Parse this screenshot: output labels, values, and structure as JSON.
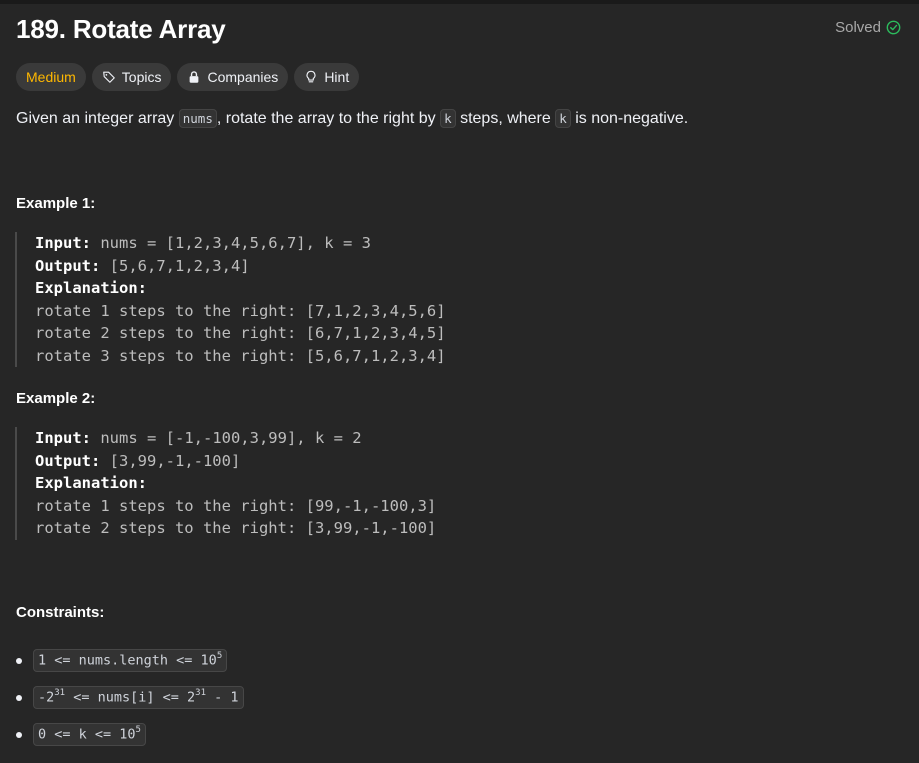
{
  "problem": {
    "title": "189. Rotate Array",
    "status": "Solved"
  },
  "tags": {
    "difficulty": "Medium",
    "topics": "Topics",
    "companies": "Companies",
    "hint": "Hint"
  },
  "description": {
    "part1": "Given an integer array ",
    "code1": "nums",
    "part2": ", rotate the array to the right by ",
    "code2": "k",
    "part3": " steps, where ",
    "code3": "k",
    "part4": " is non-negative."
  },
  "examples": [
    {
      "title": "Example 1:",
      "input_label": "Input:",
      "input": " nums = [1,2,3,4,5,6,7], k = 3",
      "output_label": "Output:",
      "output": " [5,6,7,1,2,3,4]",
      "explanation_label": "Explanation:",
      "lines": [
        "rotate 1 steps to the right: [7,1,2,3,4,5,6]",
        "rotate 2 steps to the right: [6,7,1,2,3,4,5]",
        "rotate 3 steps to the right: [5,6,7,1,2,3,4]"
      ]
    },
    {
      "title": "Example 2:",
      "input_label": "Input:",
      "input": " nums = [-1,-100,3,99], k = 2",
      "output_label": "Output:",
      "output": " [3,99,-1,-100]",
      "explanation_label": "Explanation:",
      "lines": [
        "rotate 1 steps to the right: [99,-1,-100,3]",
        "rotate 2 steps to the right: [3,99,-1,-100]"
      ]
    }
  ],
  "constraints": {
    "title": "Constraints:",
    "c1": {
      "pre": "1 <= nums.length <= 10",
      "sup": "5",
      "post": ""
    },
    "c2": {
      "pre": "-2",
      "sup": "31",
      "mid": " <= nums[i] <= 2",
      "sup2": "31",
      "post": " - 1"
    },
    "c3": {
      "pre": "0 <= k <= 10",
      "sup": "5",
      "post": ""
    }
  },
  "colors": {
    "background": "#262626",
    "medium": "#ffb800",
    "solved_check": "#2cbb5d"
  }
}
